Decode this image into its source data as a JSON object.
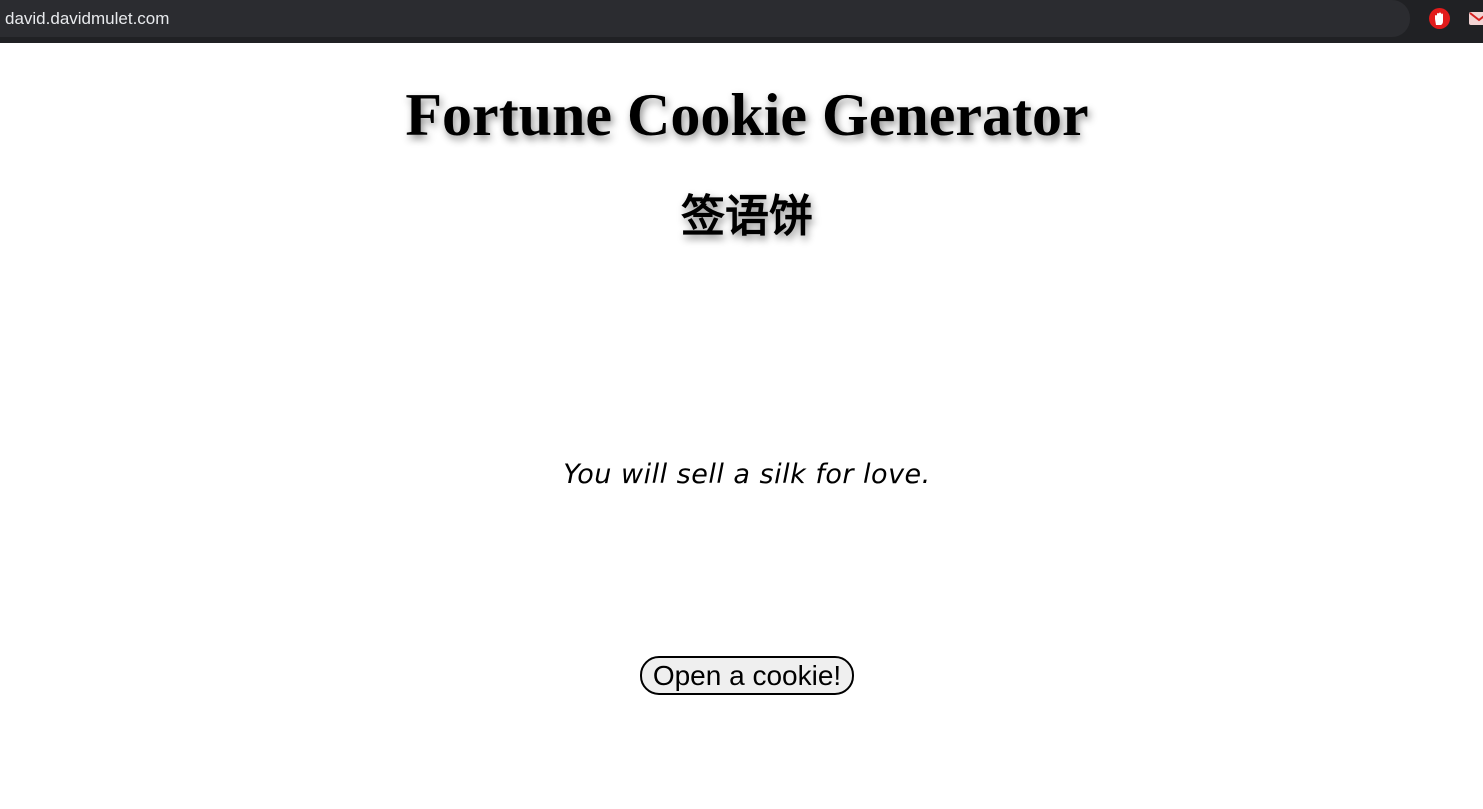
{
  "browser": {
    "url": "david.davidmulet.com",
    "extensions": [
      "adblock-hand-icon",
      "mail-extension-icon"
    ]
  },
  "page": {
    "title": "Fortune Cookie Generator",
    "subtitle": "签语饼",
    "fortune": "You will sell a silk for love.",
    "button_label": "Open a cookie!"
  },
  "colors": {
    "browser_bar": "#202124",
    "adblock_red": "#e21b1b",
    "button_bg": "#efefef",
    "text": "#000000"
  }
}
